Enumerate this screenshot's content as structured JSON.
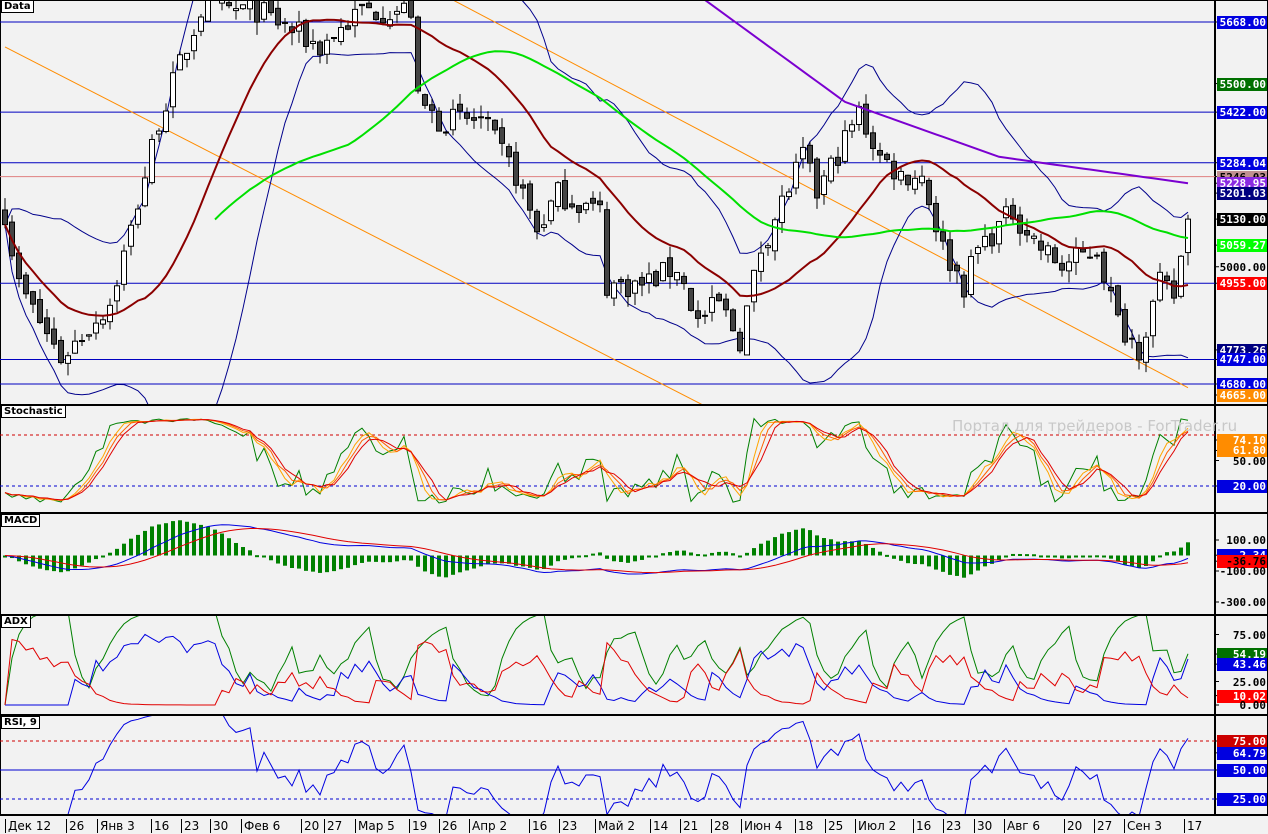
{
  "panels": {
    "main_title": "Data",
    "stoch_title": "Stochastic",
    "macd_title": "MACD",
    "adx_title": "ADX",
    "rsi_title": "RSI, 9"
  },
  "watermark": "Портал для трейдеров - ForTrader.ru",
  "main_axis": [
    {
      "text": "5668.00",
      "value": 5668,
      "bg": "#0000e0",
      "fg": "#ffffff"
    },
    {
      "text": "5500.00",
      "value": 5500,
      "bg": "#007000",
      "fg": "#ffffff"
    },
    {
      "text": "5422.00",
      "value": 5422,
      "bg": "#0000e0",
      "fg": "#ffffff"
    },
    {
      "text": "5284.04",
      "value": 5284,
      "bg": "#0000e0",
      "fg": "#ffffff"
    },
    {
      "text": "5246.03",
      "value": 5246,
      "bg": "#c09090",
      "fg": "#000000"
    },
    {
      "text": "5228.95",
      "value": 5228,
      "bg": "#8a2be2",
      "fg": "#ffffff"
    },
    {
      "text": "5201.03",
      "value": 5201,
      "bg": "#000080",
      "fg": "#ffffff"
    },
    {
      "text": "5130.00",
      "value": 5130,
      "bg": "#000000",
      "fg": "#ffffff"
    },
    {
      "text": "5059.27",
      "value": 5059,
      "bg": "#00ff00",
      "fg": "#ffffff"
    },
    {
      "text": "5000.00",
      "value": 5000,
      "bg": "transparent",
      "fg": "#000000"
    },
    {
      "text": "4955.00",
      "value": 4955,
      "bg": "#ff0000",
      "fg": "#ffffff"
    },
    {
      "text": "4773.26",
      "value": 4773,
      "bg": "#000080",
      "fg": "#ffffff"
    },
    {
      "text": "4747.00",
      "value": 4747,
      "bg": "#0000e0",
      "fg": "#ffffff"
    },
    {
      "text": "4680.00",
      "value": 4680,
      "bg": "#0000e0",
      "fg": "#ffffff"
    },
    {
      "text": "4665.00",
      "value": 4650,
      "bg": "#ff8c00",
      "fg": "#ffffff"
    }
  ],
  "stoch_axis": [
    {
      "text": "74.10",
      "value": 74.1,
      "bg": "#ff8c00",
      "fg": "#ffffff"
    },
    {
      "text": "61.80",
      "value": 61.8,
      "bg": "#ff8c00",
      "fg": "#ffffff"
    },
    {
      "text": "50.00",
      "value": 50,
      "bg": "transparent",
      "fg": "#000000"
    },
    {
      "text": "20.00",
      "value": 20,
      "bg": "#0000e0",
      "fg": "#ffffff"
    }
  ],
  "macd_axis": [
    {
      "text": "100.00",
      "value": 100,
      "bg": "transparent",
      "fg": "#000000"
    },
    {
      "text": "2.34",
      "value": 2,
      "bg": "#0000e0",
      "fg": "#ffffff"
    },
    {
      "text": "-36.76",
      "value": -36.76,
      "bg": "#ff0000",
      "fg": "#000000"
    },
    {
      "text": "-100.00",
      "value": -100,
      "bg": "transparent",
      "fg": "#000000"
    },
    {
      "text": "-300.00",
      "value": -300,
      "bg": "transparent",
      "fg": "#000000"
    }
  ],
  "adx_axis": [
    {
      "text": "75.00",
      "value": 75,
      "bg": "transparent",
      "fg": "#000000"
    },
    {
      "text": "54.19",
      "value": 54.19,
      "bg": "#007000",
      "fg": "#ffffff"
    },
    {
      "text": "43.46",
      "value": 43.46,
      "bg": "#0000e0",
      "fg": "#ffffff"
    },
    {
      "text": "25.00",
      "value": 25,
      "bg": "transparent",
      "fg": "#000000"
    },
    {
      "text": "10.02",
      "value": 10.02,
      "bg": "#ff0000",
      "fg": "#ffffff"
    },
    {
      "text": "0.00",
      "value": 0,
      "bg": "transparent",
      "fg": "#000000"
    }
  ],
  "rsi_axis": [
    {
      "text": "75.00",
      "value": 75,
      "bg": "#cc0000",
      "fg": "#ffffff"
    },
    {
      "text": "64.79",
      "value": 64.79,
      "bg": "#0000e0",
      "fg": "#ffffff"
    },
    {
      "text": "50.00",
      "value": 50,
      "bg": "#0000e0",
      "fg": "#ffffff"
    },
    {
      "text": "25.00",
      "value": 25,
      "bg": "#0000e0",
      "fg": "#ffffff"
    }
  ],
  "dates": [
    "Дек 12",
    "26",
    "Янв 3",
    "16",
    "23",
    "30",
    "Фев 6",
    "20",
    "27",
    "Мар 5",
    "19",
    "26",
    "Апр 2",
    "16",
    "23",
    "Май 2",
    "14",
    "21",
    "28",
    "Июн 4",
    "18",
    "25",
    "Июл 2",
    "16",
    "23",
    "30",
    "Авг 6",
    "20",
    "27",
    "Сен 3",
    "17"
  ],
  "chart_data": {
    "type": "candlestick",
    "bars": 170,
    "close_keyframes": [
      [
        0,
        5150
      ],
      [
        2,
        4950
      ],
      [
        8,
        4750
      ],
      [
        15,
        4900
      ],
      [
        18,
        5100
      ],
      [
        22,
        5400
      ],
      [
        28,
        5700
      ],
      [
        36,
        5700
      ],
      [
        45,
        5600
      ],
      [
        51,
        5700
      ],
      [
        58,
        5700
      ],
      [
        59,
        5450
      ],
      [
        62,
        5400
      ],
      [
        68,
        5400
      ],
      [
        73,
        5250
      ],
      [
        76,
        5100
      ],
      [
        79,
        5200
      ],
      [
        85,
        5150
      ],
      [
        86,
        4950
      ],
      [
        91,
        4950
      ],
      [
        96,
        5000
      ],
      [
        99,
        4850
      ],
      [
        102,
        4900
      ],
      [
        105,
        4800
      ],
      [
        108,
        5050
      ],
      [
        114,
        5300
      ],
      [
        116,
        5200
      ],
      [
        122,
        5420
      ],
      [
        125,
        5300
      ],
      [
        128,
        5250
      ],
      [
        131,
        5250
      ],
      [
        134,
        5050
      ],
      [
        137,
        4950
      ],
      [
        139,
        5050
      ],
      [
        144,
        5150
      ],
      [
        148,
        5050
      ],
      [
        151,
        5000
      ],
      [
        156,
        5050
      ],
      [
        159,
        4850
      ],
      [
        162,
        4780
      ],
      [
        165,
        4950
      ],
      [
        167,
        4920
      ],
      [
        169,
        5130
      ]
    ],
    "sma200_keyframes": [
      [
        100,
        5728
      ],
      [
        120,
        5450
      ],
      [
        142,
        5300
      ],
      [
        169,
        5228
      ]
    ],
    "horizontal_levels": [
      5668,
      5422,
      5284,
      5246,
      4955,
      4747,
      4680
    ],
    "trendlines": [
      [
        [
          0,
          5600
        ],
        [
          101,
          4610
        ]
      ],
      [
        [
          64,
          5728
        ],
        [
          169,
          4670
        ]
      ]
    ],
    "stoch_levels": [
      80,
      20
    ],
    "rsi_levels": [
      75,
      50,
      25
    ],
    "ylim_main": [
      4610,
      5728
    ],
    "ylim_stoch": [
      0,
      100
    ],
    "ylim_macd": [
      -330,
      170
    ],
    "ylim_adx": [
      0,
      100
    ],
    "ylim_rsi": [
      10,
      90
    ]
  }
}
